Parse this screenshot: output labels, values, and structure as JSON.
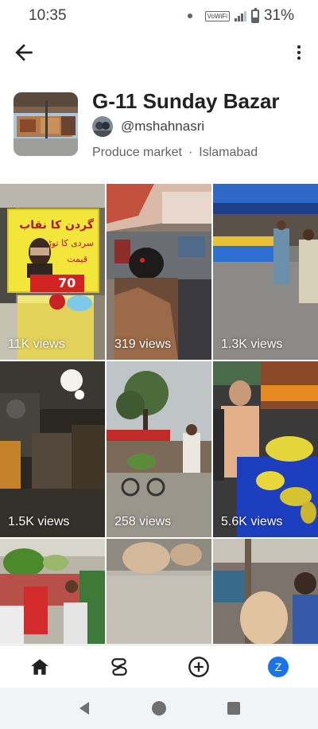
{
  "status_bar": {
    "time": "10:35",
    "vowifi": "VoWiFi",
    "battery": "31%"
  },
  "place": {
    "title": "G-11 Sunday Bazar",
    "username": "@mshahnasri",
    "category": "Produce market",
    "separator": "·",
    "location": "Islamabad"
  },
  "grid": [
    {
      "views": "11K views",
      "sign_line1": "گردن کا نقاب",
      "sign_line2": "سردی کا توڑ",
      "sign_line3": "قیمت",
      "sign_price": "70"
    },
    {
      "views": "319 views"
    },
    {
      "views": "1.3K views"
    },
    {
      "views": "1.5K views"
    },
    {
      "views": "258 views"
    },
    {
      "views": "5.6K views"
    },
    {
      "views": ""
    },
    {
      "views": ""
    },
    {
      "views": ""
    }
  ],
  "bottom_nav": {
    "profile_initial": "Z"
  },
  "colors": {
    "accent": "#1a73e8",
    "text_primary": "#202124",
    "text_secondary": "#5f6368"
  },
  "icons": [
    "back-arrow-icon",
    "more-vert-icon",
    "home-icon",
    "shorts-icon",
    "add-circle-icon",
    "nav-back-icon",
    "nav-home-icon",
    "nav-recents-icon"
  ]
}
